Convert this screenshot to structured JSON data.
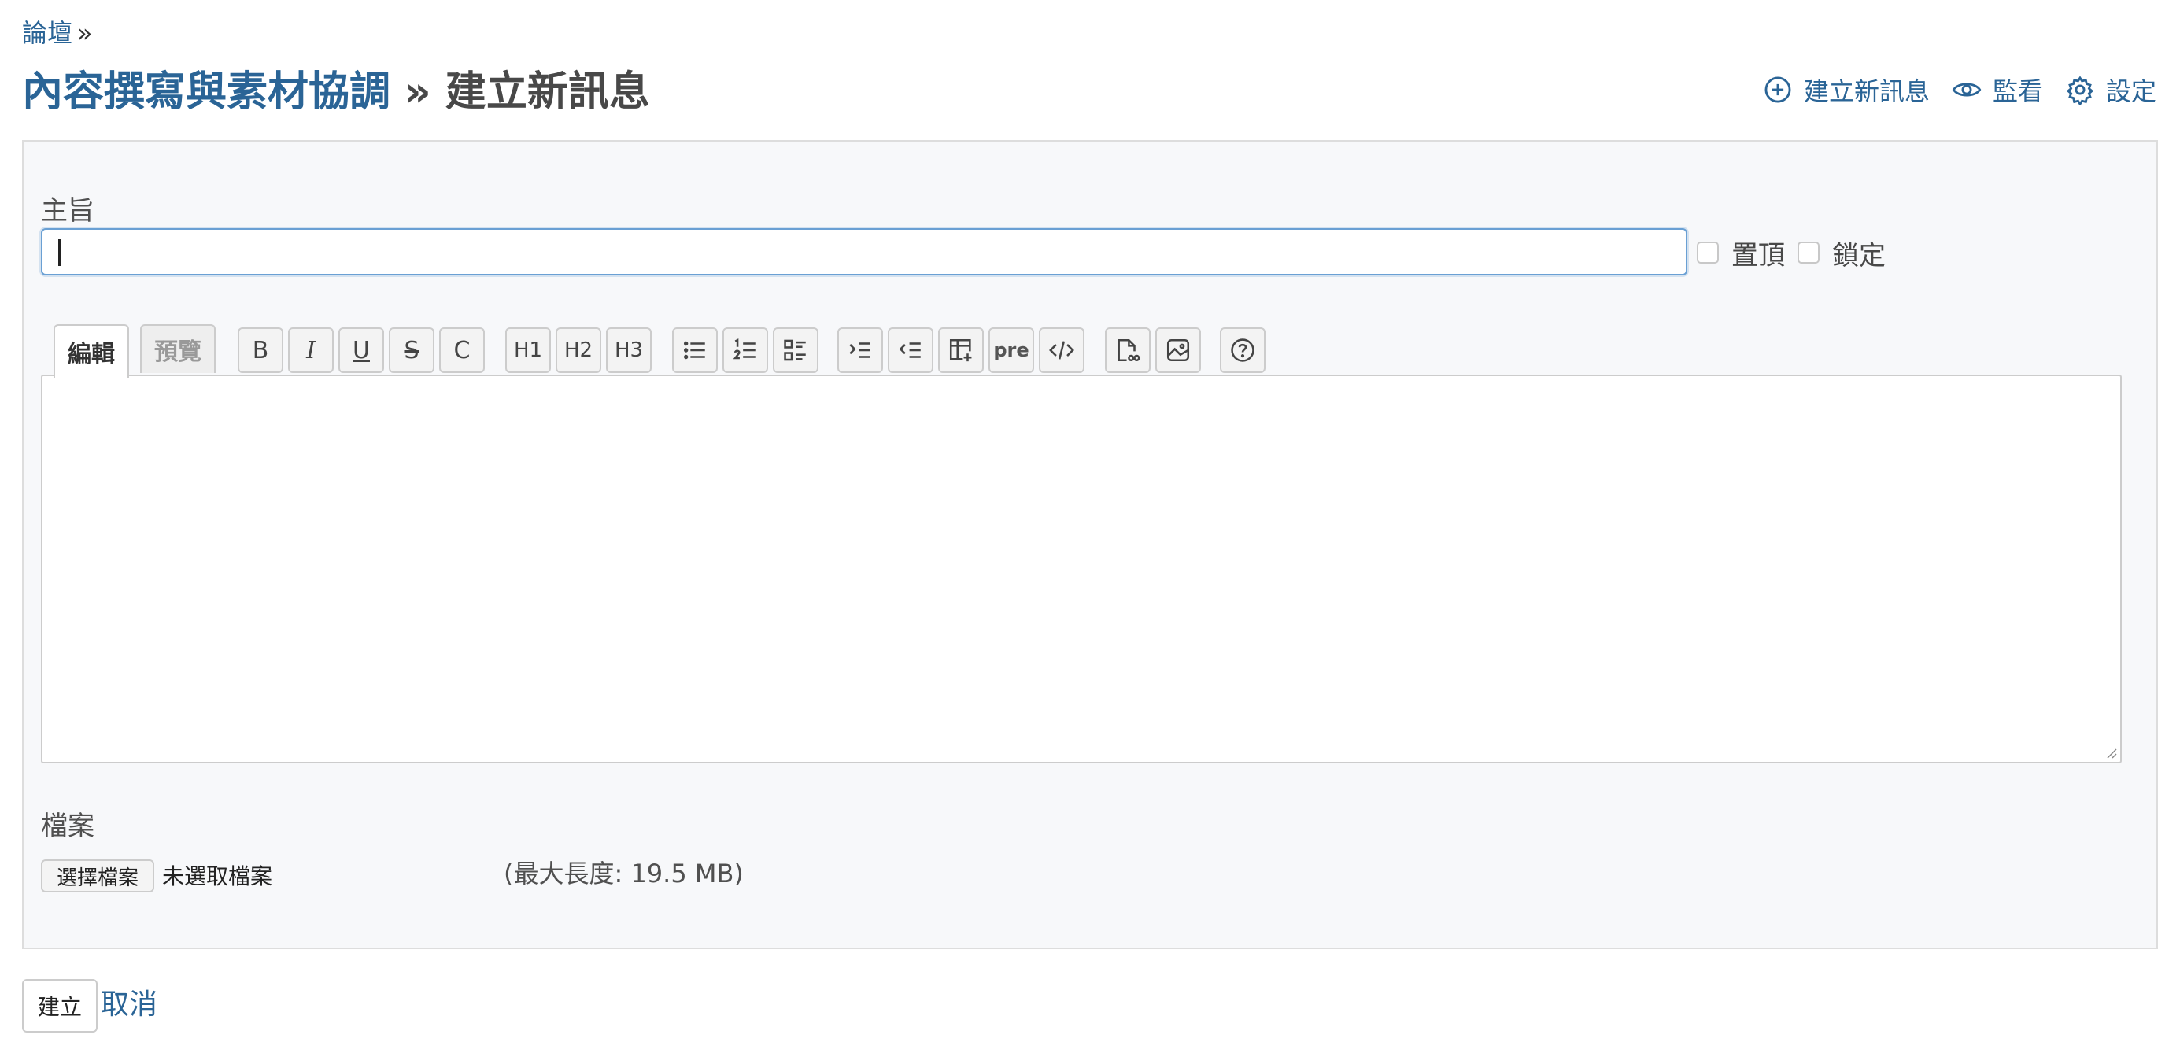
{
  "breadcrumb": {
    "forum": "論壇",
    "separator": "»"
  },
  "title": {
    "board": "內容撰寫與素材協調",
    "separator": "»",
    "page": "建立新訊息"
  },
  "contextual": {
    "new_message": "建立新訊息",
    "watch": "監看",
    "settings": "設定"
  },
  "form": {
    "subject_label": "主旨",
    "subject_value": "",
    "sticky_label": "置頂",
    "locked_label": "鎖定",
    "tabs": {
      "edit": "編輯",
      "preview": "預覽"
    },
    "toolbar": {
      "bold": "B",
      "italic": "I",
      "underline": "U",
      "strike": "S",
      "code_inline": "C",
      "h1": "H1",
      "h2": "H2",
      "h3": "H3",
      "pre": "pre"
    },
    "files_label": "檔案",
    "choose_file": "選擇檔案",
    "no_file": "未選取檔案",
    "max_size": "(最大長度: 19.5 MB)"
  },
  "actions": {
    "create": "建立",
    "cancel": "取消"
  },
  "colors": {
    "link": "#2a6496",
    "box_bg": "#f7f8fa",
    "focus_border": "#6aa0d4"
  }
}
